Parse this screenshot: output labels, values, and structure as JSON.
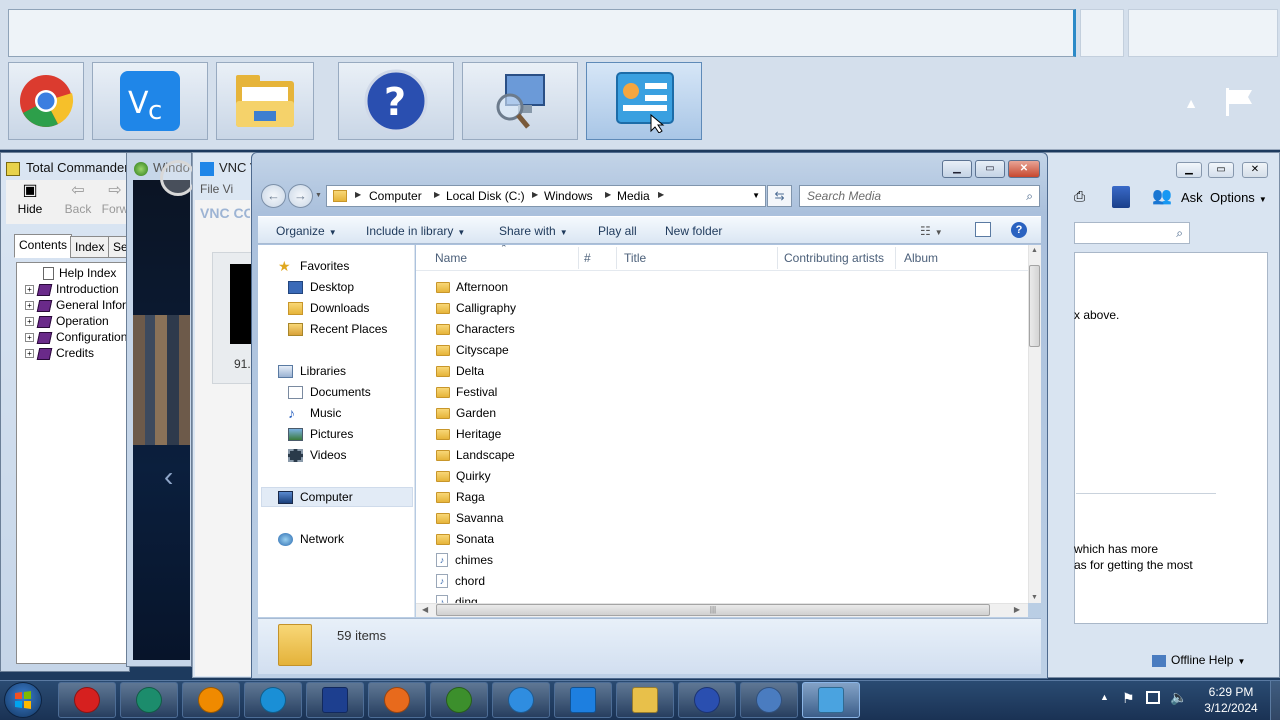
{
  "preview_strip": {
    "tiles": [
      {
        "name": "chrome",
        "icon": "chrome-icon"
      },
      {
        "name": "vnc",
        "icon": "vnc-viewer-icon"
      },
      {
        "name": "explorer",
        "icon": "folder-icon"
      },
      {
        "name": "help",
        "icon": "help-icon"
      },
      {
        "name": "remote",
        "icon": "computer-search-icon"
      },
      {
        "name": "control",
        "icon": "control-panel-icon"
      }
    ]
  },
  "total_commander_help": {
    "title": "Total Commander",
    "toolbar": {
      "hide": "Hide",
      "back": "Back",
      "forward": "Forw"
    },
    "tabs": {
      "contents": "Contents",
      "index": "Index",
      "search": "Se"
    },
    "tree": {
      "help_index": "Help Index",
      "introduction": "Introduction",
      "general": "General Inform",
      "operation": "Operation",
      "configuration": "Configuration",
      "credits": "Credits"
    }
  },
  "media_player": {
    "title": "Windo"
  },
  "vnc_window": {
    "title": "VNC V",
    "menu": "File  Vi",
    "logo": "VNC CO",
    "value": "91."
  },
  "help_window": {
    "ask": "Ask",
    "options": "Options",
    "text1": "x above.",
    "text2": "which has more",
    "text3": "as for getting the most",
    "offline": "Offline Help"
  },
  "explorer": {
    "breadcrumb": [
      "Computer",
      "Local Disk (C:)",
      "Windows",
      "Media"
    ],
    "search_placeholder": "Search Media",
    "commands": {
      "organize": "Organize",
      "include": "Include in library",
      "share": "Share with",
      "play_all": "Play all",
      "new_folder": "New folder"
    },
    "nav": {
      "favorites": "Favorites",
      "desktop": "Desktop",
      "downloads": "Downloads",
      "recent": "Recent Places",
      "libraries": "Libraries",
      "documents": "Documents",
      "music": "Music",
      "pictures": "Pictures",
      "videos": "Videos",
      "computer": "Computer",
      "network": "Network"
    },
    "columns": {
      "name": "Name",
      "num": "#",
      "title": "Title",
      "artists": "Contributing artists",
      "album": "Album"
    },
    "items": [
      {
        "name": "Afternoon",
        "kind": "folder"
      },
      {
        "name": "Calligraphy",
        "kind": "folder"
      },
      {
        "name": "Characters",
        "kind": "folder"
      },
      {
        "name": "Cityscape",
        "kind": "folder"
      },
      {
        "name": "Delta",
        "kind": "folder"
      },
      {
        "name": "Festival",
        "kind": "folder"
      },
      {
        "name": "Garden",
        "kind": "folder"
      },
      {
        "name": "Heritage",
        "kind": "folder"
      },
      {
        "name": "Landscape",
        "kind": "folder"
      },
      {
        "name": "Quirky",
        "kind": "folder"
      },
      {
        "name": "Raga",
        "kind": "folder"
      },
      {
        "name": "Savanna",
        "kind": "folder"
      },
      {
        "name": "Sonata",
        "kind": "folder"
      },
      {
        "name": "chimes",
        "kind": "audio"
      },
      {
        "name": "chord",
        "kind": "audio"
      },
      {
        "name": "ding",
        "kind": "audio"
      }
    ],
    "item_count": "59 items"
  },
  "taskbar": {
    "apps": [
      {
        "name": "opera",
        "icon": "opera-icon",
        "color": "#d6201f"
      },
      {
        "name": "app-green",
        "icon": "globe-icon",
        "color": "#1c8c6c"
      },
      {
        "name": "vlc",
        "icon": "vlc-cone-icon",
        "color": "#f08a00"
      },
      {
        "name": "edge",
        "icon": "edge-icon",
        "color": "#1a8fd6"
      },
      {
        "name": "save",
        "icon": "floppy-disk-icon",
        "color": "#1d3f8f"
      },
      {
        "name": "firefox",
        "icon": "firefox-icon",
        "color": "#e86a1c"
      },
      {
        "name": "windows",
        "icon": "windows-logo-icon",
        "color": "#3c8f2c"
      },
      {
        "name": "chrome",
        "icon": "chrome-icon",
        "color": "#2f8de0"
      },
      {
        "name": "vnc",
        "icon": "vnc-viewer-icon",
        "color": "#1d7fe0"
      },
      {
        "name": "explorer",
        "icon": "folder-icon",
        "color": "#e8c04a"
      },
      {
        "name": "help",
        "icon": "help-icon",
        "color": "#2a4fb0"
      },
      {
        "name": "remote",
        "icon": "computer-search-icon",
        "color": "#4a7cc0"
      },
      {
        "name": "control",
        "icon": "control-panel-icon",
        "color": "#4aa3e0"
      }
    ],
    "time": "6:29 PM",
    "date": "3/12/2024"
  }
}
